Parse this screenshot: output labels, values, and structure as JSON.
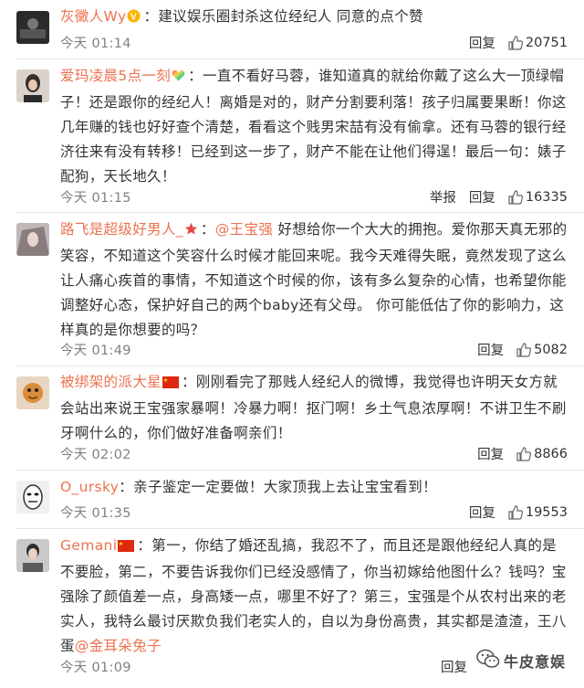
{
  "colors": {
    "username": "#eb7350",
    "text": "#333333",
    "meta": "#808080",
    "separator": "#e6e6e6"
  },
  "comments": [
    {
      "username": "灰黴人Wy",
      "badge": "v-badge-icon",
      "text": "：建议娱乐圈封杀这位经纪人 同意的点个赞",
      "time": "今天 01:14",
      "actions": [
        "回复"
      ],
      "likes": "20751"
    },
    {
      "username": "爱玛凌晨5点一刻",
      "badge": "rainbow-heart-icon",
      "text": "：一直不看好马蓉，谁知道真的就给你戴了这么大一顶绿帽子！还是跟你的经纪人！离婚是对的，财产分割要利落！孩子归属要果断！你这几年赚的钱也好好查个清楚，看看这个贱男宋喆有没有偷拿。还有马蓉的银行经济往来有没有转移！已经到这一步了，财产不能在让他们得逞！最后一句：婊子配狗，天长地久！",
      "time": "今天 01:15",
      "actions": [
        "举报",
        "回复"
      ],
      "likes": "16335"
    },
    {
      "username": "路飞是超级好男人_",
      "badge": "star-icon",
      "mention": "@王宝强",
      "text": " 好想给你一个大大的拥抱。爱你那天真无邪的笑容，不知道这个笑容什么时候才能回来呢。我今天难得失眠，竟然发现了这么让人痛心疾首的事情，不知道这个时候的你，该有多么复杂的心情，也希望你能调整好心态，保护好自己的两个baby还有父母。 你可能低估了你的影响力，这样真的是你想要的吗？",
      "time": "今天 01:49",
      "actions": [
        "回复"
      ],
      "likes": "5082"
    },
    {
      "username": "被绑架的派大星",
      "badge": "china-flag-icon",
      "text": "：刚刚看完了那贱人经纪人的微博，我觉得也许明天女方就会站出来说王宝强家暴啊！冷暴力啊！抠门啊！乡土气息浓厚啊！不讲卫生不刷牙啊什么的，你们做好准备啊亲们！",
      "time": "今天 02:02",
      "actions": [
        "回复"
      ],
      "likes": "8866"
    },
    {
      "username": "O_ursky",
      "badge": "",
      "text": "：亲子鉴定一定要做！大家顶我上去让宝宝看到！",
      "time": "今天 01:35",
      "actions": [
        "回复"
      ],
      "likes": "19553"
    },
    {
      "username": "Gemani",
      "badge": "china-flag-icon",
      "text": "：第一，你结了婚还乱搞，我忍不了，而且还是跟他经纪人真的是不要脸，第二，不要告诉我你们已经没感情了，你当初嫁给他图什么？钱吗？宝强除了颜值差一点，身高矮一点，哪里不好了？第三，宝强是个从农村出来的老实人，我特么最讨厌欺负我们老实人的，自以为身份高贵，其实都是渣渣，王八蛋",
      "mention_tail": "@金耳朵兔子",
      "time": "今天 01:09",
      "actions": [
        "回复"
      ],
      "likes": ""
    }
  ],
  "watermark": {
    "text": "牛皮意娱",
    "icon": "wechat-icon"
  }
}
